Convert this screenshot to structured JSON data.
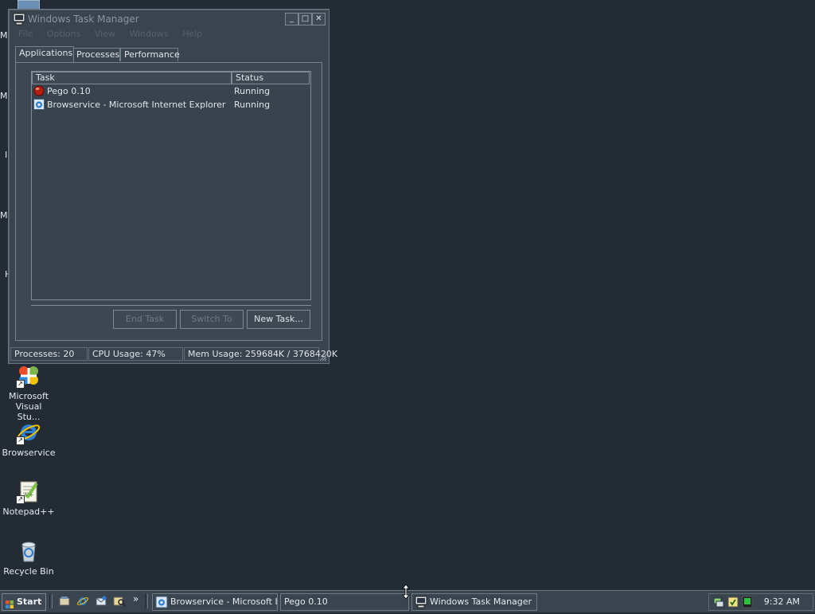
{
  "desktop": {
    "icons": [
      {
        "label": "Microsoft Visual Stu...",
        "icon": "visual-studio-icon"
      },
      {
        "label": "Browservice",
        "icon": "internet-explorer-icon"
      },
      {
        "label": "Notepad++",
        "icon": "notepad-plus-plus-icon"
      },
      {
        "label": "Recycle Bin",
        "icon": "recycle-bin-icon"
      }
    ],
    "partial_labels": [
      "M",
      "M",
      "I",
      "M",
      "H"
    ]
  },
  "window": {
    "title": "Windows Task Manager",
    "controls": {
      "minimize": "_",
      "maximize": "□",
      "close": "✕"
    },
    "menu": [
      "File",
      "Options",
      "View",
      "Windows",
      "Help"
    ],
    "tabs": [
      "Applications",
      "Processes",
      "Performance"
    ],
    "active_tab": "Applications",
    "columns": {
      "task": "Task",
      "status": "Status"
    },
    "rows": [
      {
        "task": "Pego 0.10",
        "status": "Running",
        "icon": "pego-icon"
      },
      {
        "task": "Browservice - Microsoft Internet Explorer",
        "status": "Running",
        "icon": "internet-explorer-icon"
      }
    ],
    "buttons": {
      "end_task": "End Task",
      "switch_to": "Switch To",
      "new_task": "New Task..."
    },
    "status": {
      "processes": "Processes: 20",
      "cpu": "CPU Usage: 47%",
      "mem": "Mem Usage: 259684K / 3768420K"
    }
  },
  "taskbar": {
    "start": "Start",
    "quick_launch_more": "»",
    "buttons": [
      {
        "label": "Browservice - Microsoft I...",
        "icon": "internet-explorer-icon"
      },
      {
        "label": "Pego 0.10",
        "icon": ""
      },
      {
        "label": "Windows Task Manager",
        "icon": "task-manager-icon"
      }
    ],
    "clock": "9:32 AM"
  },
  "colors": {
    "desktop": "#232b35",
    "window": "#3a444e",
    "border": "#74808a",
    "text": "#e1e5e9",
    "disabled_text": "#6f7982"
  }
}
